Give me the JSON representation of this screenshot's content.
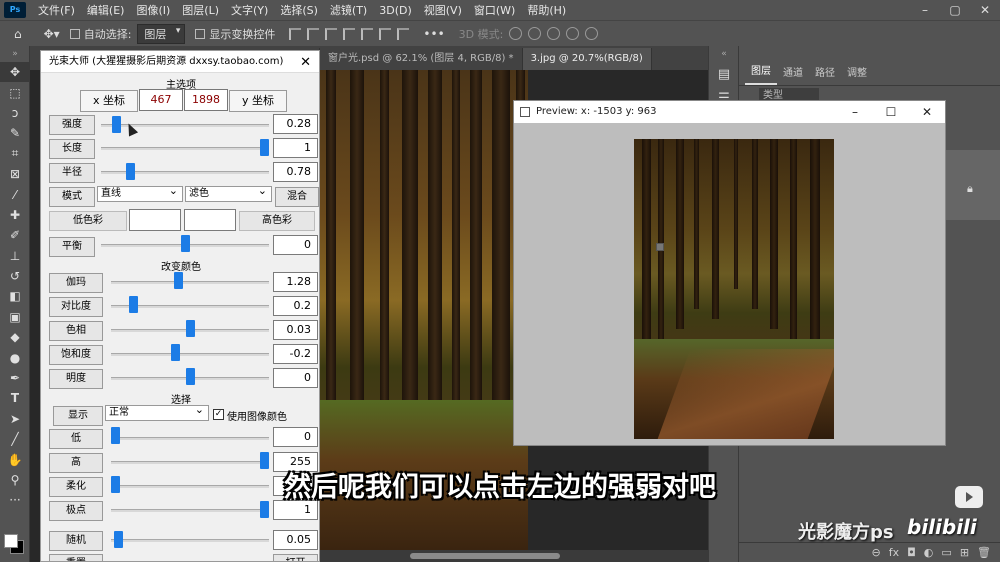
{
  "menubar": {
    "logo": "Ps",
    "items": [
      "文件(F)",
      "编辑(E)",
      "图像(I)",
      "图层(L)",
      "文字(Y)",
      "选择(S)",
      "滤镜(T)",
      "3D(D)",
      "视图(V)",
      "窗口(W)",
      "帮助(H)"
    ]
  },
  "options": {
    "auto_select_label": "自动选择:",
    "layer_dropdown": "图层",
    "show_transform_label": "显示变换控件",
    "mode_3d_label": "3D 模式:"
  },
  "doc_tabs": [
    "窗户光.psd @ 62.1% (图层 4, RGB/8) *",
    "3.jpg @ 20.7%(RGB/8)"
  ],
  "right_panel": {
    "tabs": [
      "图层",
      "通道",
      "路径",
      "调整"
    ],
    "search_placeholder": "类型"
  },
  "plugin": {
    "title": "光束大师 (大猩猩摄影后期资源 dxxsy.taobao.com)",
    "main_options": "主选项",
    "x_label": "x 坐标",
    "x_value": "467",
    "y_value": "1898",
    "y_label": "y 坐标",
    "rows1": [
      {
        "label": "强度",
        "value": "0.28",
        "level": 0.07
      },
      {
        "label": "长度",
        "value": "1",
        "level": 1.0
      },
      {
        "label": "半径",
        "value": "0.78",
        "level": 0.16
      }
    ],
    "mode_label": "模式",
    "mode_value": "直线",
    "blend_value": "滤色",
    "mix_button": "混合",
    "low_color_label": "低色彩",
    "high_color_label": "高色彩",
    "balance": {
      "label": "平衡",
      "value": "0",
      "level": 0.5
    },
    "change_color": "改变颜色",
    "rows2": [
      {
        "label": "伽玛",
        "value": "1.28",
        "level": 0.42
      },
      {
        "label": "对比度",
        "value": "0.2",
        "level": 0.12
      },
      {
        "label": "色相",
        "value": "0.03",
        "level": 0.5
      },
      {
        "label": "饱和度",
        "value": "-0.2",
        "level": 0.4
      },
      {
        "label": "明度",
        "value": "0",
        "level": 0.5
      }
    ],
    "select_title": "选择",
    "display_label": "显示",
    "display_value": "正常",
    "use_image_color": "使用图像颜色",
    "rows3": [
      {
        "label": "低",
        "value": "0",
        "level": 0.0
      },
      {
        "label": "高",
        "value": "255",
        "level": 1.0
      },
      {
        "label": "柔化",
        "value": "0",
        "level": 0.0
      },
      {
        "label": "极点",
        "value": "1",
        "level": 1.0
      }
    ],
    "random": {
      "label": "随机",
      "value": "0.05",
      "level": 0.02
    },
    "reset_label": "重置",
    "open_label": "打开"
  },
  "preview": {
    "title": "Preview:  x: -1503 y: 963"
  },
  "subtitle": "然后呢我们可以点击左边的强弱对吧",
  "watermark": {
    "channel": "光影魔方ps",
    "site": "bilibili"
  }
}
